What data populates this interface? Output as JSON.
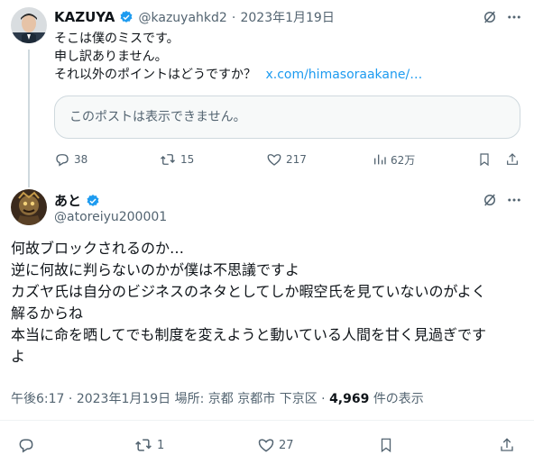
{
  "reply_tweet": {
    "display_name": "KAZUYA",
    "handle": "@kazuyahkd2",
    "separator": "·",
    "date": "2023年1月19日",
    "lines": [
      "そこは僕のミスです。",
      "申し訳ありません。",
      "それ以外のポイントはどうですか？"
    ],
    "link_text": "x.com/himasoraakane/…",
    "quoted_unavailable": "このポストは表示できません。",
    "stats": {
      "replies": "38",
      "reposts": "15",
      "likes": "217",
      "views": "62万"
    }
  },
  "main_tweet": {
    "display_name": "あと",
    "handle": "@atoreiyu200001",
    "lines": [
      "何故ブロックされるのか…",
      "逆に何故に判らないのかが僕は不思議ですよ",
      "カズヤ氏は自分のビジネスのネタとしてしか暇空氏を見ていないのがよく",
      "解るからね",
      "本当に命を晒してでも制度を変えようと動いている人間を甘く見過ぎです",
      "よ"
    ],
    "time": "午後6:17",
    "sep1": "·",
    "date": "2023年1月19日",
    "location": "場所: 京都 京都市 下京区",
    "sep2": "·",
    "views_count": "4,969",
    "views_label": "件の表示",
    "stats": {
      "reposts": "1",
      "likes": "27"
    }
  },
  "colors": {
    "accent": "#1d9bf0",
    "muted": "#536471",
    "text": "#0f1419"
  }
}
